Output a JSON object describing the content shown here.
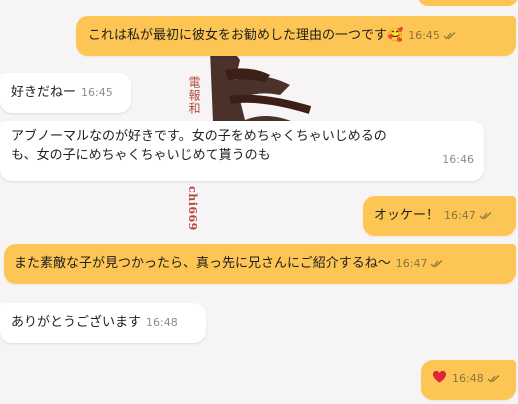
{
  "wallpaper": {
    "seal_chars": "電報和",
    "seal_latin": "chi669"
  },
  "messages": [
    {
      "id": "m1",
      "direction": "out",
      "text": "これは私が最初に彼女をお勧めした理由の一つです",
      "emoji": "🥰",
      "time": "16:45",
      "status": "read"
    },
    {
      "id": "m2",
      "direction": "in",
      "text": "好きだねー",
      "time": "16:45"
    },
    {
      "id": "m3",
      "direction": "in",
      "line1": "アブノーマルなのが好きです。女の子をめちゃくちゃいじめるの",
      "line2": "も、女の子にめちゃくちゃいじめて貰うのも",
      "time": "16:46"
    },
    {
      "id": "m4",
      "direction": "out",
      "text": "オッケー！",
      "time": "16:47",
      "status": "read"
    },
    {
      "id": "m5",
      "direction": "out",
      "text": "また素敵な子が見つかったら、真っ先に兄さんにご紹介するね～",
      "time": "16:47",
      "status": "read"
    },
    {
      "id": "m6",
      "direction": "in",
      "text": "ありがとうございます",
      "time": "16:48"
    },
    {
      "id": "m7",
      "direction": "out",
      "text": "",
      "emoji": "❤️",
      "time": "16:48",
      "status": "read"
    }
  ],
  "colors": {
    "outgoing_bubble": "#fdc553",
    "incoming_bubble": "#ffffff",
    "background": "#f7f4f5"
  }
}
